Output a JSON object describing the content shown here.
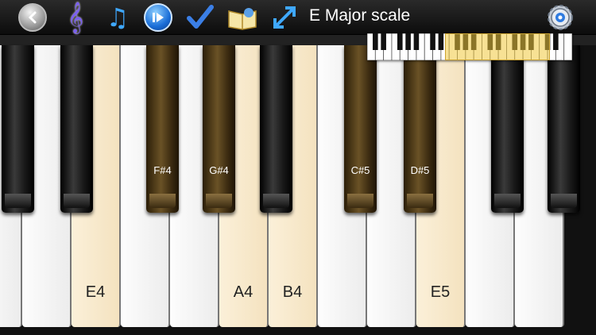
{
  "header": {
    "title": "E Major scale",
    "icons": [
      "back-icon",
      "treble-clef-icon",
      "music-notes-icon",
      "play-skip-icon",
      "checkmark-icon",
      "book-icon",
      "expand-arrows-icon",
      "gear-icon"
    ]
  },
  "colors": {
    "scale_white": "#f4e2bf",
    "scale_black": "#6a5226",
    "highlight": "#f0c83c",
    "accent_blue": "#1a6ed8"
  },
  "keyboard": {
    "white_keys": [
      {
        "label": "",
        "scale": false
      },
      {
        "label": "",
        "scale": false
      },
      {
        "label": "E4",
        "scale": true
      },
      {
        "label": "",
        "scale": false
      },
      {
        "label": "",
        "scale": false
      },
      {
        "label": "A4",
        "scale": true
      },
      {
        "label": "B4",
        "scale": true
      },
      {
        "label": "",
        "scale": false
      },
      {
        "label": "",
        "scale": false
      },
      {
        "label": "E5",
        "scale": true
      },
      {
        "label": "",
        "scale": false
      },
      {
        "label": "",
        "scale": false
      }
    ],
    "black_keys": [
      {
        "label": "",
        "scale": false
      },
      {
        "label": "",
        "scale": false
      },
      {
        "label": "F#4",
        "scale": true
      },
      {
        "label": "G#4",
        "scale": true
      },
      {
        "label": "",
        "scale": false
      },
      {
        "label": "C#5",
        "scale": true
      },
      {
        "label": "D#5",
        "scale": true
      },
      {
        "label": "",
        "scale": false
      },
      {
        "label": "",
        "scale": false
      }
    ]
  }
}
